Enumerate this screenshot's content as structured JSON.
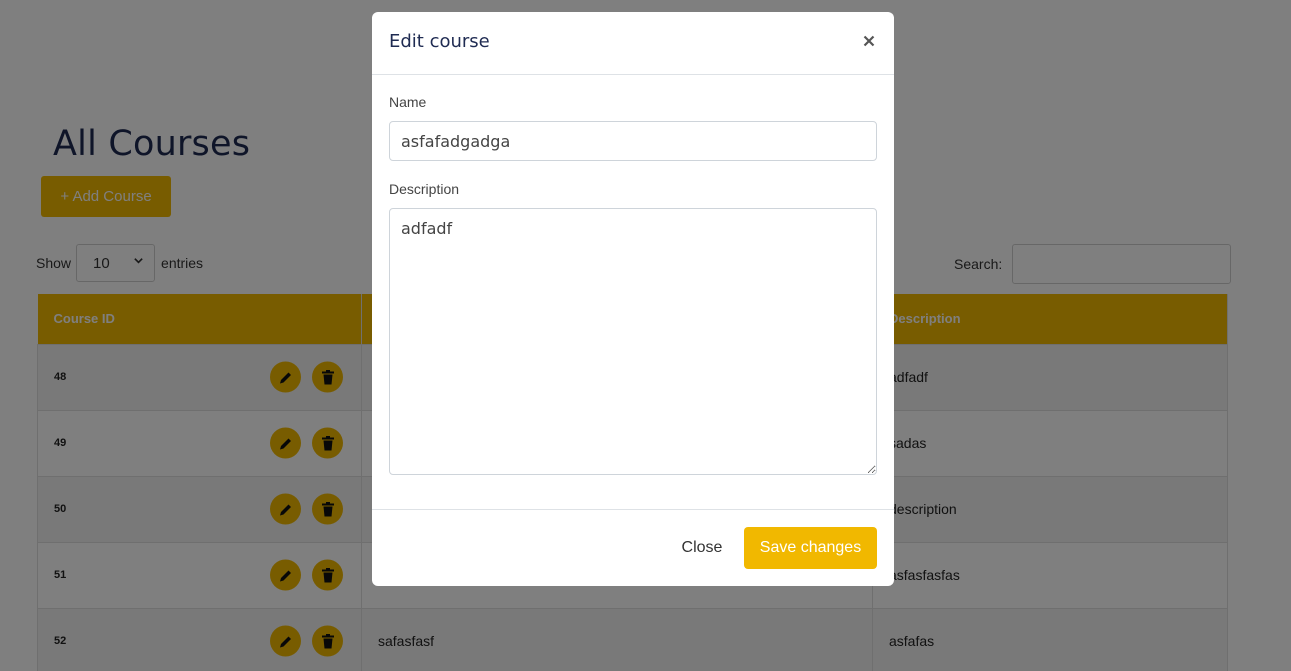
{
  "page": {
    "title": "All Courses",
    "add_button": "+ Add Course",
    "show_label": "Show",
    "entries_value": "10",
    "entries_label": "entries",
    "search_label": "Search:"
  },
  "table": {
    "headers": [
      "Course ID",
      "",
      "Description"
    ],
    "rows": [
      {
        "id": "48",
        "name": "",
        "description": "adfadf"
      },
      {
        "id": "49",
        "name": "",
        "description": "sadas"
      },
      {
        "id": "50",
        "name": "",
        "description": "description"
      },
      {
        "id": "51",
        "name": "",
        "description": "asfasfasfas"
      },
      {
        "id": "52",
        "name": "safasfasf",
        "description": "asfafas"
      }
    ]
  },
  "modal": {
    "title": "Edit course",
    "close_icon": "×",
    "name_label": "Name",
    "name_value": "asfafadgadga",
    "description_label": "Description",
    "description_value": "adfadf",
    "close_button": "Close",
    "save_button": "Save changes"
  },
  "colors": {
    "accent": "#f1b800",
    "title": "#1f2b52",
    "backdrop": "rgba(0,0,0,0.5)"
  },
  "icons": [
    "pencil-icon",
    "trash-icon",
    "chevron-down-icon",
    "close-icon"
  ]
}
